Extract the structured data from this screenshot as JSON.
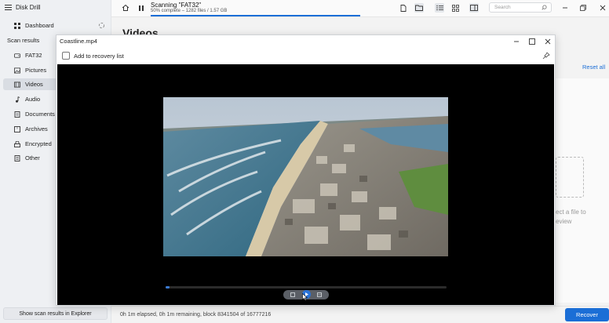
{
  "app": {
    "title": "Disk Drill"
  },
  "sidebar": {
    "dashboard": "Dashboard",
    "section_label": "Scan results",
    "items": [
      {
        "label": "FAT32",
        "icon": "drive-icon"
      },
      {
        "label": "Pictures",
        "icon": "picture-icon"
      },
      {
        "label": "Videos",
        "icon": "video-icon",
        "active": true
      },
      {
        "label": "Audio",
        "icon": "music-note-icon"
      },
      {
        "label": "Documents",
        "icon": "document-icon"
      },
      {
        "label": "Archives",
        "icon": "archive-icon"
      },
      {
        "label": "Encrypted",
        "icon": "lock-icon"
      },
      {
        "label": "Other",
        "icon": "file-icon"
      }
    ],
    "footer_button": "Show scan results in Explorer"
  },
  "topbar": {
    "scan_title": "Scanning \"FAT32\"",
    "scan_subtitle": "50% complete – 1282 files / 1.57 GB",
    "progress": 0.5,
    "search_placeholder": "Search"
  },
  "main": {
    "title": "Videos",
    "reset_all": "Reset all",
    "preview_hint_line1": "ect a file to",
    "preview_hint_line2": "eview"
  },
  "statusbar": {
    "text": "0h 1m elapsed, 0h 1m remaining, block 8341504 of 16777216",
    "recover_label": "Recover"
  },
  "dialog": {
    "title": "Coastline.mp4",
    "add_to_list": "Add to recovery list",
    "playback_progress": 0.01
  },
  "colors": {
    "accent": "#1b6ed6",
    "sidebar_bg": "#eef0f3",
    "video_bg": "#000000"
  }
}
